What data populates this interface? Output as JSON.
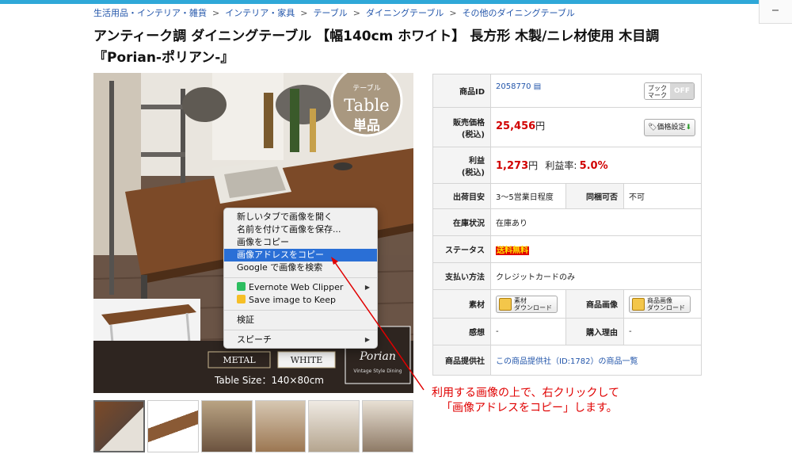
{
  "breadcrumb": [
    "生活用品・インテリア・雑貨",
    "インテリア・家具",
    "テーブル",
    "ダイニングテーブル",
    "その他のダイニングテーブル"
  ],
  "product_title": "アンティーク調 ダイニングテーブル 【幅140cm ホワイト】 長方形 木製/ニレ材使用 木目調『Porian-ポリアン-』",
  "image_overlay": {
    "badge_small": "テーブル",
    "badge_big": "Table",
    "badge_sub": "単品",
    "tag_metal": "METAL",
    "tag_white": "WHITE",
    "size": "Table Size：140×80cm",
    "brand": "Porian",
    "brand_sub": "Vintage Style Dining"
  },
  "context_menu": {
    "items": [
      "新しいタブで画像を開く",
      "名前を付けて画像を保存...",
      "画像をコピー",
      "画像アドレスをコピー",
      "Google で画像を検索",
      "Evernote Web Clipper",
      "Save image to Keep",
      "検証",
      "スピーチ"
    ]
  },
  "info": {
    "id_label": "商品ID",
    "id_value": "2058770",
    "bookmark_top": "ブック",
    "bookmark_bottom": "マーク",
    "bookmark_state": "OFF",
    "price_label_1": "販売価格",
    "price_label_2": "(税込)",
    "price_value": "25,456",
    "price_unit": "円",
    "price_button": "価格設定",
    "profit_label_1": "利益",
    "profit_label_2": "(税込)",
    "profit_value": "1,273",
    "profit_unit": "円",
    "profit_rate_label": "利益率:",
    "profit_rate": "5.0%",
    "ship_label": "出荷目安",
    "ship_value": "3〜5営業日程度",
    "bundle_label": "同梱可否",
    "bundle_value": "不可",
    "stock_label": "在庫状況",
    "stock_value": "在庫あり",
    "status_label": "ステータス",
    "status_value": "送料無料",
    "pay_label": "支払い方法",
    "pay_value": "クレジットカードのみ",
    "material_label": "素材",
    "material_btn_1": "素材",
    "material_btn_2": "ダウンロード",
    "img_label": "商品画像",
    "img_btn_1": "商品画像",
    "img_btn_2": "ダウンロード",
    "review_label": "感想",
    "review_value": "-",
    "reason_label": "購入理由",
    "reason_value": "-",
    "supplier_label": "商品提供社",
    "supplier_value": "この商品提供社（ID:1782）の商品一覧"
  },
  "annotation": {
    "line1": "利用する画像の上で、右クリックして",
    "line2": "「画像アドレスをコピー」します。"
  },
  "colors": {
    "accent": "#2fa8d8",
    "link": "#2255aa",
    "highlight": "#2a6fd6",
    "annotation": "#e00000"
  }
}
